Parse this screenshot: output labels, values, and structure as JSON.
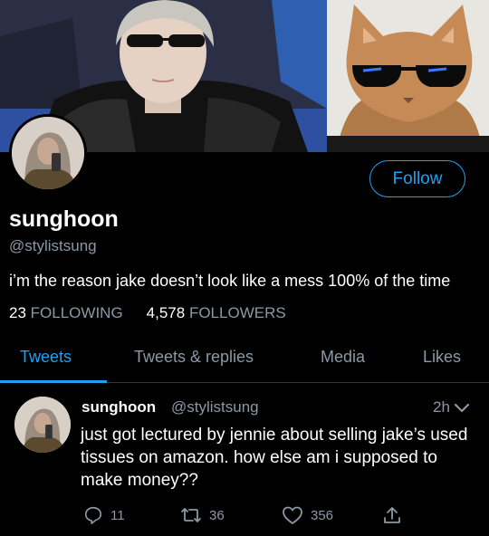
{
  "profile": {
    "follow_label": "Follow",
    "name": "sunghoon",
    "handle": "@stylistsung",
    "bio": "i’m the reason jake doesn’t look like a mess 100% of the time",
    "following_count": "23",
    "following_label": "FOLLOWING",
    "followers_count": "4,578",
    "followers_label": "FOLLOWERS"
  },
  "tabs": [
    {
      "label": "Tweets",
      "active": true
    },
    {
      "label": "Tweets & replies",
      "active": false
    },
    {
      "label": "Media",
      "active": false
    },
    {
      "label": "Likes",
      "active": false
    }
  ],
  "tweet": {
    "name": "sunghoon",
    "handle": "@stylistsung",
    "time": "2h",
    "text": "just got lectured by jennie about selling jake’s used tissues on amazon. how else am i supposed to make money??",
    "replies": "11",
    "retweets": "36",
    "likes": "356"
  },
  "colors": {
    "accent": "#1da1f2",
    "muted": "#8b98a5",
    "background": "#000000"
  },
  "icons": [
    "reply-icon",
    "retweet-icon",
    "like-icon",
    "share-icon",
    "chevron-down-icon"
  ]
}
